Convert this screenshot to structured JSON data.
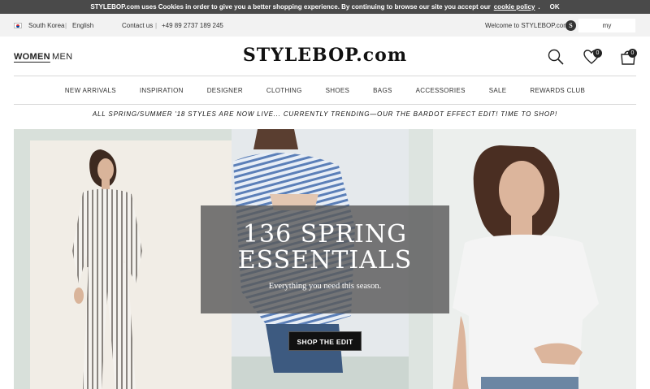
{
  "cookie_bar": {
    "message": "STYLEBOP.com uses Cookies in order to give you a better shopping experience. By continuing to browse our site you accept our",
    "policy_link": "cookie policy",
    "period": ".",
    "ok_label": "OK"
  },
  "utility_bar": {
    "country": "South Korea",
    "separator": "|",
    "language": "English",
    "contact_label": "Contact us",
    "phone": "+49 89 2737 189 245",
    "welcome": "Welcome to STYLEBOP.com!",
    "account_initial": "S",
    "account_label": "my STYLEBOP.com"
  },
  "header": {
    "women_label": "WOMEN",
    "men_label": "MEN",
    "logo": "STYLEBOP.com",
    "wishlist_count": "0",
    "bag_count": "0",
    "icons": [
      "search-icon",
      "heart-icon",
      "shopping-bag-icon"
    ]
  },
  "nav": {
    "items": [
      "NEW ARRIVALS",
      "INSPIRATION",
      "DESIGNER",
      "CLOTHING",
      "SHOES",
      "BAGS",
      "ACCESSORIES",
      "SALE",
      "REWARDS CLUB"
    ]
  },
  "promo": {
    "text": "ALL SPRING/SUMMER '18 STYLES ARE NOW LIVE... CURRENTLY TRENDING—OUR THE BARDOT EFFECT EDIT! TIME TO SHOP!"
  },
  "hero": {
    "title_line1": "136 SPRING",
    "title_line2": "ESSENTIALS",
    "subtitle": "Everything you need this season.",
    "cta_label": "SHOP THE EDIT"
  }
}
